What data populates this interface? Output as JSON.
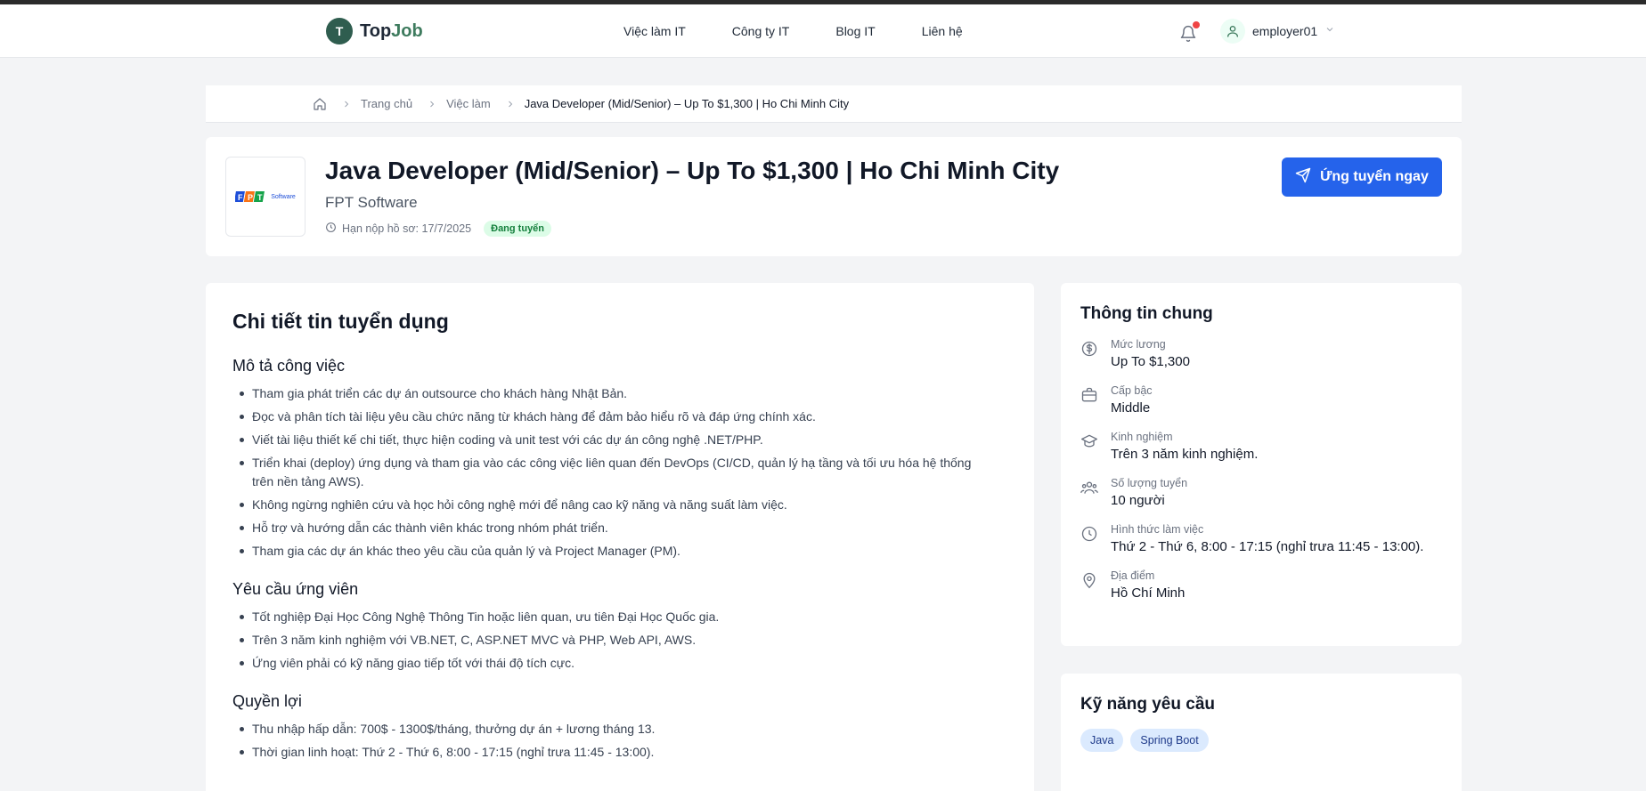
{
  "brand": {
    "initial": "T",
    "name_part1": "Top",
    "name_part2": "Job"
  },
  "nav": [
    "Việc làm IT",
    "Công ty IT",
    "Blog IT",
    "Liên hệ"
  ],
  "user": {
    "name": "employer01"
  },
  "breadcrumb": [
    "Trang chủ",
    "Việc làm",
    "Java Developer (Mid/Senior) – Up To $1,300 | Ho Chi Minh City"
  ],
  "job": {
    "title": "Java Developer (Mid/Senior) – Up To $1,300 | Ho Chi Minh City",
    "company": "FPT Software",
    "deadline": "Hạn nộp hồ sơ: 17/7/2025",
    "status": "Đang tuyển",
    "apply_label": "Ứng tuyển ngay",
    "logo_text": "Software"
  },
  "detail": {
    "title": "Chi tiết tin tuyển dụng",
    "sections": [
      {
        "title": "Mô tả công việc",
        "items": [
          "Tham gia phát triển các dự án outsource cho khách hàng Nhật Bản.",
          "Đọc và phân tích tài liệu yêu cầu chức năng từ khách hàng để đảm bảo hiểu rõ và đáp ứng chính xác.",
          "Viết tài liệu thiết kế chi tiết, thực hiện coding và unit test với các dự án công nghệ .NET/PHP.",
          "Triển khai (deploy) ứng dụng và tham gia vào các công việc liên quan đến DevOps (CI/CD, quản lý hạ tầng và tối ưu hóa hệ thống trên nền tảng AWS).",
          "Không ngừng nghiên cứu và học hỏi công nghệ mới để nâng cao kỹ năng và năng suất làm việc.",
          "Hỗ trợ và hướng dẫn các thành viên khác trong nhóm phát triển.",
          "Tham gia các dự án khác theo yêu cầu của quản lý và Project Manager (PM)."
        ]
      },
      {
        "title": "Yêu cầu ứng viên",
        "items": [
          "Tốt nghiệp Đại Học Công Nghệ Thông Tin hoặc liên quan, ưu tiên Đại Học Quốc gia.",
          "Trên 3 năm kinh nghiệm với VB.NET, C, ASP.NET MVC và PHP, Web API, AWS.",
          "Ứng viên phải có kỹ năng giao tiếp tốt với thái độ tích cực."
        ]
      },
      {
        "title": "Quyền lợi",
        "items": [
          "Thu nhập hấp dẫn: 700$ - 1300$/tháng, thưởng dự án + lương tháng 13.",
          "Thời gian linh hoạt: Thứ 2 - Thứ 6, 8:00 - 17:15 (nghỉ trưa 11:45 - 13:00)."
        ]
      }
    ]
  },
  "info": {
    "title": "Thông tin chung",
    "rows": [
      {
        "icon": "dollar-icon",
        "label": "Mức lương",
        "value": "Up To $1,300"
      },
      {
        "icon": "briefcase-icon",
        "label": "Cấp bậc",
        "value": "Middle"
      },
      {
        "icon": "graduation-cap-icon",
        "label": "Kinh nghiệm",
        "value": "Trên 3 năm kinh nghiệm."
      },
      {
        "icon": "users-icon",
        "label": "Số lượng tuyển",
        "value": "10 người"
      },
      {
        "icon": "clock-icon",
        "label": "Hình thức làm việc",
        "value": "Thứ 2 - Thứ 6, 8:00 - 17:15 (nghỉ trưa 11:45 - 13:00)."
      },
      {
        "icon": "map-pin-icon",
        "label": "Địa điểm",
        "value": "Hồ Chí Minh"
      }
    ]
  },
  "skills": {
    "title": "Kỹ năng yêu cầu",
    "items": [
      "Java",
      "Spring Boot"
    ]
  },
  "colors": {
    "primary": "#2563eb",
    "brand": "#2f5d4f",
    "status_bg": "#dcfce7",
    "status_fg": "#15803d",
    "notification_dot": "#ef4444"
  }
}
